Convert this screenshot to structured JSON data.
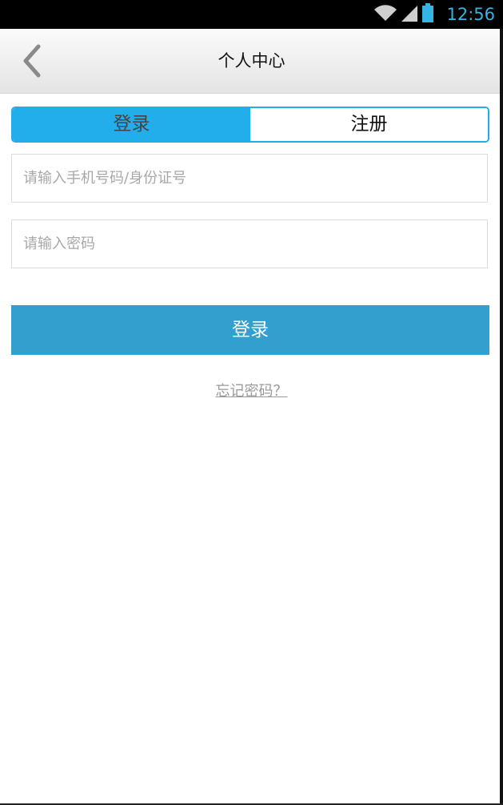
{
  "status_bar": {
    "time": "12:56",
    "icons": [
      "wifi-icon",
      "signal-icon",
      "battery-icon"
    ],
    "accent_color": "#33b5e5"
  },
  "nav": {
    "title": "个人中心",
    "back_icon": "chevron-left-icon"
  },
  "tabs": [
    {
      "label": "登录",
      "active": true
    },
    {
      "label": "注册",
      "active": false
    }
  ],
  "form": {
    "account_placeholder": "请输入手机号码/身份证号",
    "account_value": "",
    "password_placeholder": "请输入密码",
    "password_value": ""
  },
  "login_button": {
    "label": "登录"
  },
  "forgot_link": {
    "label": "忘记密码？"
  },
  "colors": {
    "tab_accent": "#22aeea",
    "button": "#339fcf",
    "link": "#9a9a9a"
  }
}
